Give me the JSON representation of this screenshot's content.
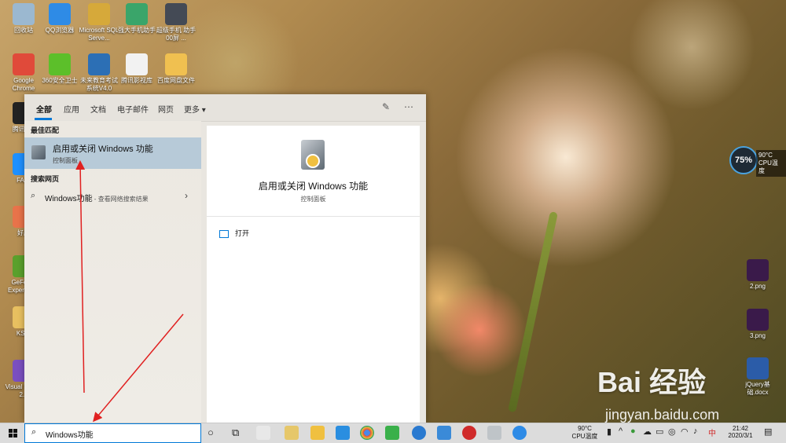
{
  "desktop": {
    "icons_left": [
      {
        "label": "回收站",
        "color": "#9bb8d0"
      },
      {
        "label": "QQ浏览器",
        "color": "#2e8be6"
      },
      {
        "label": "Microsoft SQL Serve...",
        "color": "#d6a93a"
      },
      {
        "label": "强大手机助手",
        "color": "#3aa56a"
      },
      {
        "label": "超级手机 助手 00屏 ...",
        "color": "#444a55"
      },
      {
        "label": "Google Chrome",
        "color": "#e04a3a"
      },
      {
        "label": "360安全卫士",
        "color": "#5cbf2a"
      },
      {
        "label": "未来教育考试系统V4.0",
        "color": "#2c6fb5"
      },
      {
        "label": "腾讯影视库",
        "color": "#f2f2f2"
      },
      {
        "label": "百度网盘文件",
        "color": "#f0c050"
      },
      {
        "label": "腾讯QQ",
        "color": "#222"
      },
      {
        "label": "FA录",
        "color": "#1e90ff"
      },
      {
        "label": "好压",
        "color": "#e8734a"
      },
      {
        "label": "GeForce Experience",
        "color": "#5aa02c"
      },
      {
        "label": "KSW",
        "color": "#e8c060"
      },
      {
        "label": "Visual Studio 2...",
        "color": "#7a4fc0"
      }
    ],
    "icons_right": [
      {
        "label": "2.png",
        "color": "#3a1a4a"
      },
      {
        "label": "3.png",
        "color": "#3a1a4a"
      },
      {
        "label": "jQuery基础.docx",
        "color": "#2b5ca8"
      }
    ],
    "cpu_gauge": {
      "percent": "75%",
      "temp": "90°C",
      "label": "CPU温度"
    },
    "watermark": {
      "brand": "Bai 经验",
      "url": "jingyan.baidu.com"
    }
  },
  "start_panel": {
    "tabs": [
      "全部",
      "应用",
      "文档",
      "电子邮件",
      "网页",
      "更多 ▾"
    ],
    "best_match_heading": "最佳匹配",
    "best_match": {
      "title": "启用或关闭 Windows 功能",
      "subtitle": "控制面板"
    },
    "web_heading": "搜索网页",
    "web_result": {
      "query": "Windows功能",
      "suffix": " - 查看网络搜索结果"
    },
    "detail": {
      "title": "启用或关闭 Windows 功能",
      "subtitle": "控制面板",
      "open_label": "打开"
    }
  },
  "taskbar": {
    "search_value": "Windows功能",
    "cpu_temp": "90°C",
    "cpu_label": "CPU温度",
    "ime": "中",
    "time": "21:42",
    "date": "2020/3/1"
  }
}
